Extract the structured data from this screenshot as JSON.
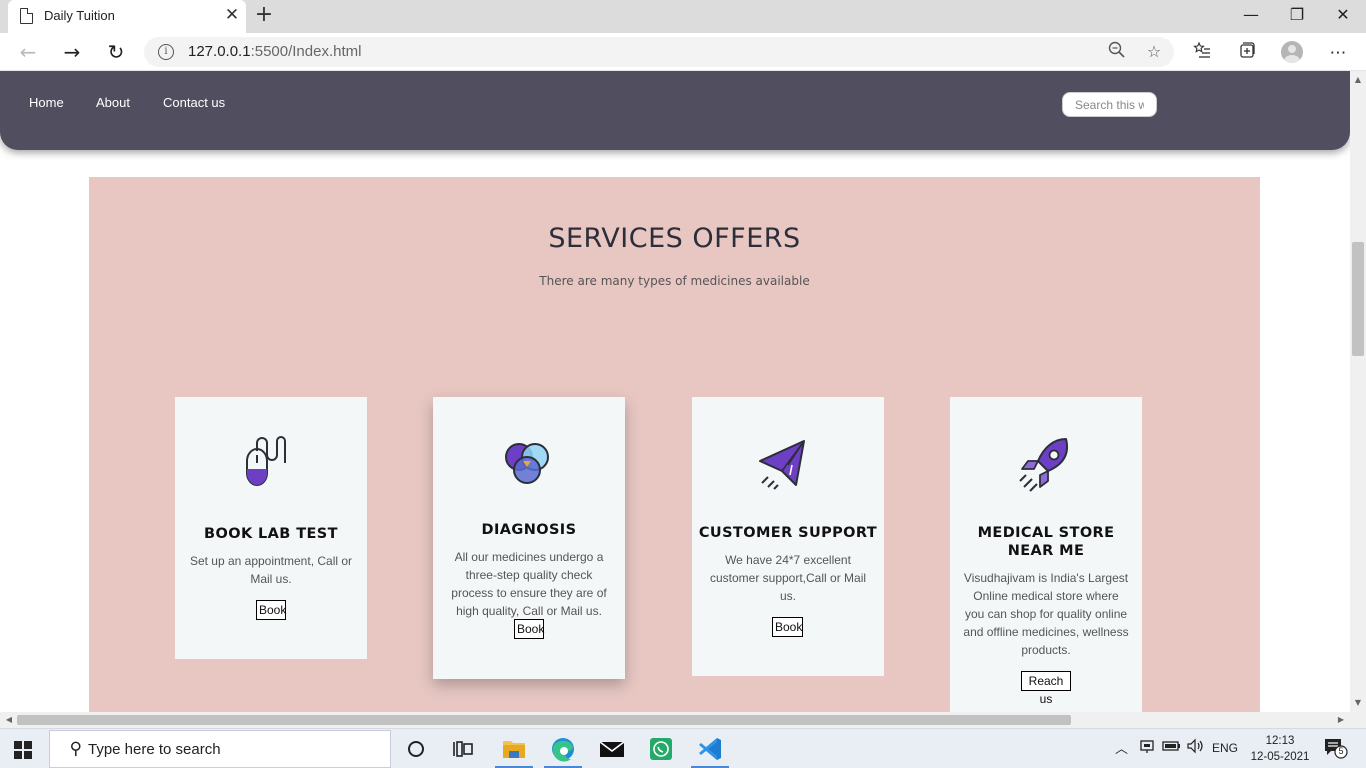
{
  "browser": {
    "tab_title": "Daily Tuition",
    "url_host": "127.0.0.1",
    "url_rest": ":5500/Index.html"
  },
  "site": {
    "nav": [
      "Home",
      "About",
      "Contact us"
    ],
    "search_placeholder": "Search this w"
  },
  "services": {
    "title": "SERVICES OFFERS",
    "subtitle": "There are many types of medicines available",
    "cards": [
      {
        "icon": "mouse-icon",
        "title": "BOOK LAB TEST",
        "text": "Set up an appointment, Call or Mail us.",
        "button": "Book"
      },
      {
        "icon": "venn-circles-icon",
        "title": "DIAGNOSIS",
        "text": "All our medicines undergo a three-step quality check process to ensure they are of high quality, Call or Mail us.",
        "button": "Book"
      },
      {
        "icon": "paper-plane-icon",
        "title": "CUSTOMER SUPPORT",
        "text": "We have 24*7 excellent customer support,Call or Mail us.",
        "button": "Book"
      },
      {
        "icon": "rocket-icon",
        "title": "MEDICAL STORE NEAR ME",
        "text": "Visudhajivam is India's Largest Online medical store where you can shop for quality online and offline medicines, wellness products.",
        "button": "Reach us"
      }
    ]
  },
  "taskbar": {
    "search_text": "Type here to search",
    "language": "ENG",
    "time": "12:13",
    "date": "12-05-2021",
    "notification_count": "5"
  },
  "colors": {
    "nav_bg": "#514e60",
    "section_bg": "#e8c7c3",
    "card_bg": "#f4f7f8",
    "icon_purple": "#6d3fc5"
  }
}
